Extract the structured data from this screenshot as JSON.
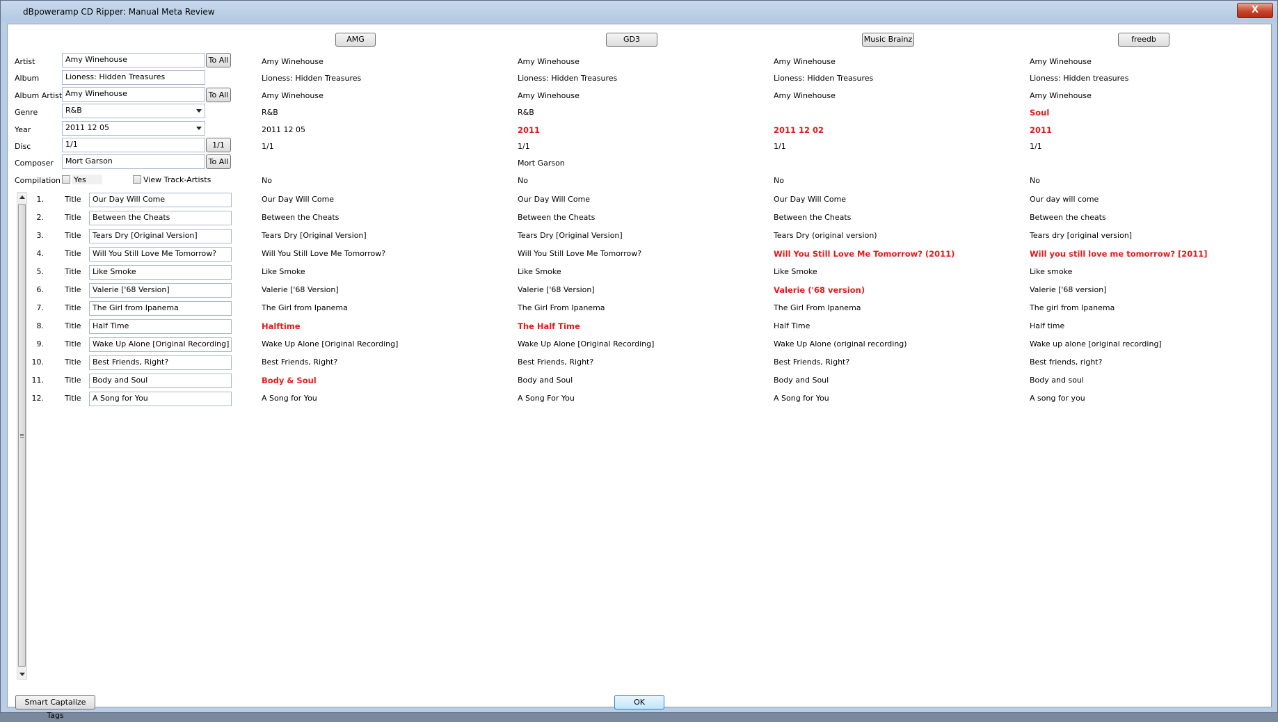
{
  "window": {
    "title": "dBpoweramp CD Ripper: Manual Meta Review",
    "close": "X"
  },
  "sources": [
    "AMG",
    "GD3",
    "Music Brainz",
    "freedb"
  ],
  "fields": {
    "artist": {
      "label": "Artist",
      "value": "Amy Winehouse",
      "button": "To All"
    },
    "album": {
      "label": "Album",
      "value": "Lioness: Hidden Treasures"
    },
    "album_artist": {
      "label": "Album Artist",
      "value": "Amy Winehouse",
      "button": "To All"
    },
    "genre": {
      "label": "Genre",
      "value": "R&B"
    },
    "year": {
      "label": "Year",
      "value": "2011 12 05"
    },
    "disc": {
      "label": "Disc",
      "value": "1/1",
      "button": "1/1"
    },
    "composer": {
      "label": "Composer",
      "value": "Mort Garson",
      "button": "To All"
    },
    "compilation": {
      "label": "Compilation",
      "checkbox_label": "Yes"
    },
    "view_track_artists": {
      "label": "View Track-Artists"
    }
  },
  "meta_values": [
    [
      {
        "t": "Amy Winehouse",
        "d": false
      },
      {
        "t": "Lioness: Hidden Treasures",
        "d": false
      },
      {
        "t": "Amy Winehouse",
        "d": false
      },
      {
        "t": "R&B",
        "d": false
      },
      {
        "t": "2011 12 05",
        "d": false
      },
      {
        "t": "1/1",
        "d": false
      },
      {
        "t": "",
        "d": false
      },
      {
        "t": "No",
        "d": false
      }
    ],
    [
      {
        "t": "Amy Winehouse",
        "d": false
      },
      {
        "t": "Lioness: Hidden Treasures",
        "d": false
      },
      {
        "t": "Amy Winehouse",
        "d": false
      },
      {
        "t": "R&B",
        "d": false
      },
      {
        "t": "2011",
        "d": true
      },
      {
        "t": "1/1",
        "d": false
      },
      {
        "t": "Mort Garson",
        "d": false
      },
      {
        "t": "No",
        "d": false
      }
    ],
    [
      {
        "t": "Amy Winehouse",
        "d": false
      },
      {
        "t": "Lioness: Hidden Treasures",
        "d": false
      },
      {
        "t": "Amy Winehouse",
        "d": false
      },
      {
        "t": "",
        "d": false
      },
      {
        "t": "2011 12 02",
        "d": true
      },
      {
        "t": "1/1",
        "d": false
      },
      {
        "t": "",
        "d": false
      },
      {
        "t": "No",
        "d": false
      }
    ],
    [
      {
        "t": "Amy Winehouse",
        "d": false
      },
      {
        "t": "Lioness: Hidden treasures",
        "d": false
      },
      {
        "t": "Amy Winehouse",
        "d": false
      },
      {
        "t": "Soul",
        "d": true
      },
      {
        "t": "2011",
        "d": true
      },
      {
        "t": "1/1",
        "d": false
      },
      {
        "t": "",
        "d": false
      },
      {
        "t": "No",
        "d": false
      }
    ]
  ],
  "track_label": "Title",
  "tracks": [
    {
      "num": "1.",
      "title": "Our Day Will Come",
      "src": [
        {
          "t": "Our Day Will Come",
          "d": false
        },
        {
          "t": "Our Day Will Come",
          "d": false
        },
        {
          "t": "Our Day Will Come",
          "d": false
        },
        {
          "t": "Our day will come",
          "d": false
        }
      ]
    },
    {
      "num": "2.",
      "title": "Between the Cheats",
      "src": [
        {
          "t": "Between the Cheats",
          "d": false
        },
        {
          "t": "Between the Cheats",
          "d": false
        },
        {
          "t": "Between the Cheats",
          "d": false
        },
        {
          "t": "Between the cheats",
          "d": false
        }
      ]
    },
    {
      "num": "3.",
      "title": "Tears Dry [Original Version]",
      "src": [
        {
          "t": "Tears Dry [Original Version]",
          "d": false
        },
        {
          "t": "Tears Dry [Original Version]",
          "d": false
        },
        {
          "t": "Tears Dry (original version)",
          "d": false
        },
        {
          "t": "Tears dry [original version]",
          "d": false
        }
      ]
    },
    {
      "num": "4.",
      "title": "Will You Still Love Me Tomorrow?",
      "src": [
        {
          "t": "Will You Still Love Me Tomorrow?",
          "d": false
        },
        {
          "t": "Will You Still Love Me Tomorrow?",
          "d": false
        },
        {
          "t": "Will You Still Love Me Tomorrow? (2011)",
          "d": true
        },
        {
          "t": "Will you still love me tomorrow? [2011]",
          "d": true
        }
      ]
    },
    {
      "num": "5.",
      "title": "Like Smoke",
      "src": [
        {
          "t": "Like Smoke",
          "d": false
        },
        {
          "t": "Like Smoke",
          "d": false
        },
        {
          "t": "Like Smoke",
          "d": false
        },
        {
          "t": "Like smoke",
          "d": false
        }
      ]
    },
    {
      "num": "6.",
      "title": "Valerie ['68 Version]",
      "src": [
        {
          "t": "Valerie ['68 Version]",
          "d": false
        },
        {
          "t": "Valerie ['68 Version]",
          "d": false
        },
        {
          "t": "Valerie ('68 version)",
          "d": true
        },
        {
          "t": "Valerie ['68 version]",
          "d": false
        }
      ]
    },
    {
      "num": "7.",
      "title": "The Girl from Ipanema",
      "src": [
        {
          "t": "The Girl from Ipanema",
          "d": false
        },
        {
          "t": "The Girl From Ipanema",
          "d": false
        },
        {
          "t": "The Girl From Ipanema",
          "d": false
        },
        {
          "t": "The girl from Ipanema",
          "d": false
        }
      ]
    },
    {
      "num": "8.",
      "title": "Half Time",
      "src": [
        {
          "t": "Halftime",
          "d": true
        },
        {
          "t": "The Half Time",
          "d": true
        },
        {
          "t": "Half Time",
          "d": false
        },
        {
          "t": "Half time",
          "d": false
        }
      ]
    },
    {
      "num": "9.",
      "title": "Wake Up Alone [Original Recording]",
      "src": [
        {
          "t": "Wake Up Alone [Original Recording]",
          "d": false
        },
        {
          "t": "Wake Up Alone [Original Recording]",
          "d": false
        },
        {
          "t": "Wake Up Alone (original recording)",
          "d": false
        },
        {
          "t": "Wake up alone [original recording]",
          "d": false
        }
      ]
    },
    {
      "num": "10.",
      "title": "Best Friends, Right?",
      "src": [
        {
          "t": "Best Friends, Right?",
          "d": false
        },
        {
          "t": "Best Friends, Right?",
          "d": false
        },
        {
          "t": "Best Friends, Right?",
          "d": false
        },
        {
          "t": "Best friends, right?",
          "d": false
        }
      ]
    },
    {
      "num": "11.",
      "title": "Body and Soul",
      "src": [
        {
          "t": "Body & Soul",
          "d": true
        },
        {
          "t": "Body and Soul",
          "d": false
        },
        {
          "t": "Body and Soul",
          "d": false
        },
        {
          "t": "Body and soul",
          "d": false
        }
      ]
    },
    {
      "num": "12.",
      "title": "A Song for You",
      "src": [
        {
          "t": "A Song for You",
          "d": false
        },
        {
          "t": "A Song For You",
          "d": false
        },
        {
          "t": "A Song for You",
          "d": false
        },
        {
          "t": "A song for you",
          "d": false
        }
      ]
    }
  ],
  "buttons": {
    "smart_capitalize": "Smart Captalize Tags",
    "ok": "OK"
  },
  "colors": {
    "difference": "#e41a1a",
    "title_bar": "#b9cde4"
  }
}
